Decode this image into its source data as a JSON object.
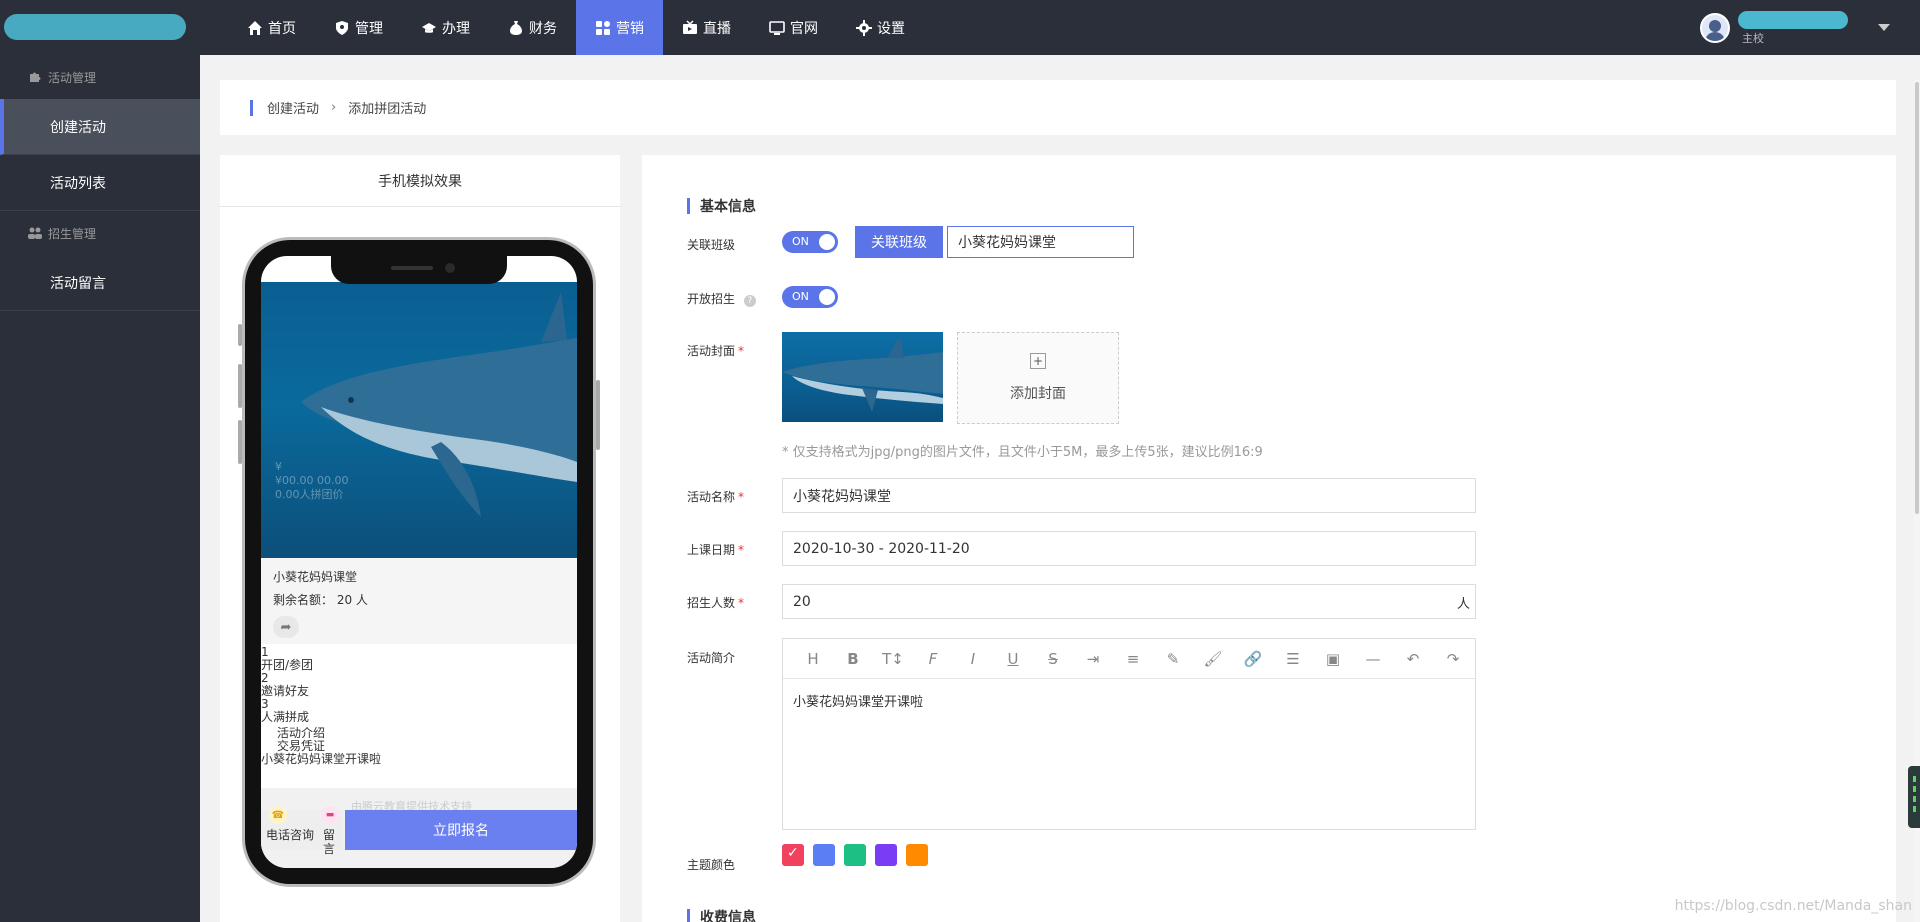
{
  "nav": {
    "items": [
      {
        "label": "首页",
        "icon": "home-icon"
      },
      {
        "label": "管理",
        "icon": "shield-icon"
      },
      {
        "label": "办理",
        "icon": "graduation-cap-icon"
      },
      {
        "label": "财务",
        "icon": "money-bag-icon"
      },
      {
        "label": "营销",
        "icon": "grid-icon",
        "active": true
      },
      {
        "label": "直播",
        "icon": "tv-icon"
      },
      {
        "label": "官网",
        "icon": "monitor-icon"
      },
      {
        "label": "设置",
        "icon": "gear-icon"
      }
    ],
    "user_role": "主校"
  },
  "sidebar": {
    "group1": "活动管理",
    "item1": "创建活动",
    "item2": "活动列表",
    "group2": "招生管理",
    "item3": "活动留言"
  },
  "breadcrumb": {
    "first": "创建活动",
    "second": "添加拼团活动"
  },
  "phone": {
    "panel_title": "手机模拟效果",
    "hero_ghost_line1": "¥",
    "hero_ghost_line2": "¥00.00 00.00",
    "hero_ghost_line3": "0.00人拼团价",
    "activity_name": "小葵花妈妈课堂",
    "remaining_label": "剩余名额：",
    "remaining_value": "20 人",
    "step1_num": "1",
    "step1": "开团/参团",
    "step2_num": "2",
    "step2": "邀请好友",
    "step3_num": "3",
    "step3": "人满拼成",
    "tab_intro": "活动介绍",
    "tab_voucher": "交易凭证",
    "intro": "小葵花妈妈课堂开课啦",
    "footer_ghost": "由腾云教育提供技术支持",
    "call_label": "电话咨询",
    "msg_label": "留言",
    "signup_button": "立即报名"
  },
  "form": {
    "section_basic": "基本信息",
    "link_class_label": "关联班级",
    "link_class_switch": "ON",
    "link_class_button": "关联班级",
    "link_class_value": "小葵花妈妈课堂",
    "open_enroll_label": "开放招生",
    "open_enroll_switch": "ON",
    "cover_label": "活动封面",
    "add_cover": "添加封面",
    "cover_hint": "* 仅支持格式为jpg/png的图片文件，且文件小于5M，最多上传5张，建议比例16:9",
    "name_label": "活动名称",
    "name_value": "小葵花妈妈课堂",
    "date_label": "上课日期",
    "date_value": "2020-10-30 - 2020-11-20",
    "count_label": "招生人数",
    "count_value": "20",
    "count_unit": "人",
    "intro_label": "活动简介",
    "intro_value": "小葵花妈妈课堂开课啦",
    "theme_label": "主题颜色",
    "theme_colors": [
      "#f2415e",
      "#5b7ef5",
      "#1dbf85",
      "#7b3cf5",
      "#ff8a00"
    ],
    "section_fee": "收费信息"
  },
  "editor_tools": [
    "H",
    "B",
    "T↕",
    "F",
    "I",
    "U",
    "S",
    "indent-icon",
    "line-height-icon",
    "eraser-icon",
    "brush-icon",
    "link-icon",
    "align-icon",
    "image-icon",
    "hr-icon",
    "undo-icon",
    "redo-icon"
  ],
  "watermark": "https://blog.csdn.net/Manda_shan"
}
